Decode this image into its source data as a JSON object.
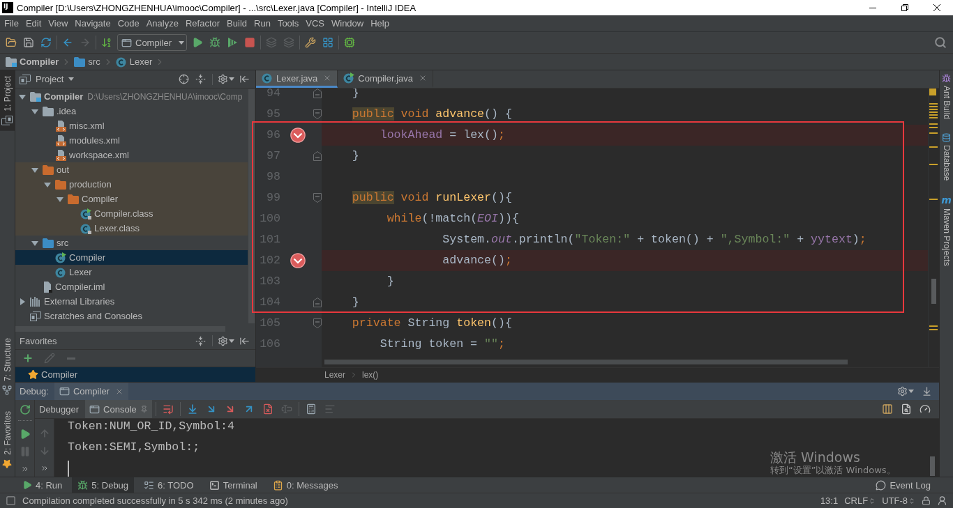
{
  "window": {
    "app_icon": "IJ",
    "title": "Compiler [D:\\Users\\ZHONGZHENHUA\\imooc\\Compiler] - ...\\src\\Lexer.java [Compiler] - IntelliJ IDEA"
  },
  "menu": [
    "File",
    "Edit",
    "View",
    "Navigate",
    "Code",
    "Analyze",
    "Refactor",
    "Build",
    "Run",
    "Tools",
    "VCS",
    "Window",
    "Help"
  ],
  "toolbar": {
    "run_configuration": "Compiler"
  },
  "nav_bar": [
    {
      "label": "Compiler",
      "kind": "module"
    },
    {
      "label": "src",
      "kind": "source-folder"
    },
    {
      "label": "Lexer",
      "kind": "class"
    }
  ],
  "left_strip": [
    {
      "label": "1: Project",
      "kind": "project",
      "selected": true
    },
    {
      "label": "7: Structure",
      "kind": "structure",
      "selected": false
    },
    {
      "label": "2: Favorites",
      "kind": "favorites",
      "selected": false
    }
  ],
  "project_panel": {
    "title": "Project",
    "tree": [
      {
        "label": "Compiler",
        "path": "D:\\Users\\ZHONGZHENHUA\\imooc\\Comp",
        "kind": "module",
        "expanded": true,
        "selected": false,
        "excluded": false,
        "children": [
          {
            "label": ".idea",
            "kind": "folder",
            "expanded": true,
            "selected": false,
            "excluded": false,
            "children": [
              {
                "label": "misc.xml",
                "kind": "xml",
                "selected": false,
                "excluded": false
              },
              {
                "label": "modules.xml",
                "kind": "xml",
                "selected": false,
                "excluded": false
              },
              {
                "label": "workspace.xml",
                "kind": "xml",
                "selected": false,
                "excluded": false
              }
            ]
          },
          {
            "label": "out",
            "kind": "folder",
            "expanded": true,
            "selected": false,
            "excluded": true,
            "children": [
              {
                "label": "production",
                "kind": "folder",
                "expanded": true,
                "selected": false,
                "excluded": true,
                "children": [
                  {
                    "label": "Compiler",
                    "kind": "folder",
                    "expanded": true,
                    "selected": false,
                    "excluded": true,
                    "children": [
                      {
                        "label": "Compiler.class",
                        "kind": "main-class-file",
                        "selected": false,
                        "excluded": true
                      },
                      {
                        "label": "Lexer.class",
                        "kind": "class-file",
                        "selected": false,
                        "excluded": true
                      }
                    ]
                  }
                ]
              }
            ]
          },
          {
            "label": "src",
            "kind": "source-folder",
            "expanded": true,
            "selected": false,
            "excluded": false,
            "children": [
              {
                "label": "Compiler",
                "kind": "main-class",
                "selected": true,
                "excluded": false
              },
              {
                "label": "Lexer",
                "kind": "class",
                "selected": false,
                "excluded": false
              }
            ]
          },
          {
            "label": "Compiler.iml",
            "kind": "module-file",
            "selected": false,
            "excluded": false
          }
        ]
      },
      {
        "label": "External Libraries",
        "kind": "libraries",
        "expanded": false,
        "selected": false,
        "excluded": false
      },
      {
        "label": "Scratches and Consoles",
        "kind": "scratches",
        "selected": false,
        "excluded": false
      }
    ]
  },
  "favorites_panel": {
    "title": "Favorites",
    "items": [
      {
        "label": "Compiler",
        "selected": true
      }
    ]
  },
  "editor": {
    "tabs": [
      {
        "label": "Lexer.java",
        "kind": "class",
        "selected": true
      },
      {
        "label": "Compiler.java",
        "kind": "main-class",
        "selected": false
      }
    ],
    "lines": [
      {
        "number": "94",
        "kind": "fold_end",
        "breakpoint": false,
        "tokens": [
          {
            "kind": "plain",
            "text": "    }"
          }
        ]
      },
      {
        "number": "95",
        "kind": "fold_start",
        "breakpoint": false,
        "tokens": [
          {
            "kind": "highlighted_keyword",
            "text": "    public"
          },
          {
            "kind": "keyword",
            "text": " void "
          },
          {
            "kind": "declaration",
            "text": "advance"
          },
          {
            "kind": "plain",
            "text": "() {"
          }
        ]
      },
      {
        "number": "96",
        "kind": "code",
        "breakpoint": true,
        "tokens": [
          {
            "kind": "field",
            "text": "        lookAhead"
          },
          {
            "kind": "plain",
            "text": " = lex()"
          },
          {
            "kind": "keyword",
            "text": ";"
          }
        ]
      },
      {
        "number": "97",
        "kind": "fold_end",
        "breakpoint": false,
        "tokens": [
          {
            "kind": "plain",
            "text": "    }"
          }
        ]
      },
      {
        "number": "98",
        "kind": "code",
        "breakpoint": false
      },
      {
        "number": "99",
        "kind": "fold_start",
        "breakpoint": false,
        "tokens": [
          {
            "kind": "highlighted_keyword",
            "text": "    public"
          },
          {
            "kind": "keyword",
            "text": " void "
          },
          {
            "kind": "declaration",
            "text": "runLexer"
          },
          {
            "kind": "plain",
            "text": "(){"
          }
        ]
      },
      {
        "number": "100",
        "kind": "code",
        "breakpoint": false,
        "tokens": [
          {
            "kind": "keyword",
            "text": "         while"
          },
          {
            "kind": "plain",
            "text": "(!match("
          },
          {
            "kind": "constant",
            "text": "EOI"
          },
          {
            "kind": "plain",
            "text": ")){"
          }
        ]
      },
      {
        "number": "101",
        "kind": "code",
        "breakpoint": false,
        "tokens": [
          {
            "kind": "plain",
            "text": "                 System."
          },
          {
            "kind": "static_field",
            "text": "out"
          },
          {
            "kind": "plain",
            "text": ".println("
          },
          {
            "kind": "string",
            "text": "\"Token:\""
          },
          {
            "kind": "plain",
            "text": " + token() + "
          },
          {
            "kind": "string",
            "text": "\",Symbol:\""
          },
          {
            "kind": "plain",
            "text": " + "
          },
          {
            "kind": "field",
            "text": "yytext"
          },
          {
            "kind": "plain",
            "text": ")"
          },
          {
            "kind": "keyword",
            "text": ";"
          }
        ]
      },
      {
        "number": "102",
        "kind": "code",
        "breakpoint": true,
        "tokens": [
          {
            "kind": "plain",
            "text": "                 advance()"
          },
          {
            "kind": "keyword",
            "text": ";"
          }
        ]
      },
      {
        "number": "103",
        "kind": "code",
        "breakpoint": false,
        "tokens": [
          {
            "kind": "plain",
            "text": "         }"
          }
        ]
      },
      {
        "number": "104",
        "kind": "fold_end",
        "breakpoint": false,
        "tokens": [
          {
            "kind": "plain",
            "text": "    }"
          }
        ]
      },
      {
        "number": "105",
        "kind": "fold_start",
        "breakpoint": false,
        "tokens": [
          {
            "kind": "keyword",
            "text": "    private "
          },
          {
            "kind": "plain",
            "text": "String "
          },
          {
            "kind": "declaration",
            "text": "token"
          },
          {
            "kind": "plain",
            "text": "(){"
          }
        ]
      },
      {
        "number": "106",
        "kind": "code",
        "breakpoint": false,
        "tokens": [
          {
            "kind": "plain",
            "text": "        String token = "
          },
          {
            "kind": "string",
            "text": "\"\""
          },
          {
            "kind": "keyword",
            "text": ";"
          }
        ]
      }
    ],
    "breadcrumb": [
      "Lexer",
      "lex()"
    ]
  },
  "right_strip": [
    {
      "label": "Ant Build",
      "kind": "ant"
    },
    {
      "label": "Database",
      "kind": "database"
    },
    {
      "label": "Maven Projects",
      "kind": "maven",
      "logo": "m"
    }
  ],
  "debug_panel": {
    "title": "Debug:",
    "session": "Compiler",
    "tabs": [
      {
        "label": "Debugger",
        "selected": false
      },
      {
        "label": "Console",
        "selected": true
      }
    ],
    "console_lines": [
      "Token:NUM_OR_ID,Symbol:4",
      "Token:SEMI,Symbol:;"
    ]
  },
  "tool_windows": [
    {
      "label": "4: Run",
      "kind": "run",
      "selected": false
    },
    {
      "label": "5: Debug",
      "kind": "debug",
      "selected": true
    },
    {
      "label": "6: TODO",
      "kind": "todo",
      "selected": false
    },
    {
      "label": "Terminal",
      "kind": "terminal",
      "selected": false
    },
    {
      "label": "0: Messages",
      "kind": "messages",
      "selected": false
    }
  ],
  "event_log": "Event Log",
  "status_bar": {
    "message": "Compilation completed successfully in 5 s 342 ms (2 minutes ago)",
    "position": "13:1",
    "line_separator": "CRLF",
    "encoding": "UTF-8"
  },
  "activation_notice": {
    "title": "激活 Windows",
    "message": "转到“设置”以激活 Windows。"
  }
}
